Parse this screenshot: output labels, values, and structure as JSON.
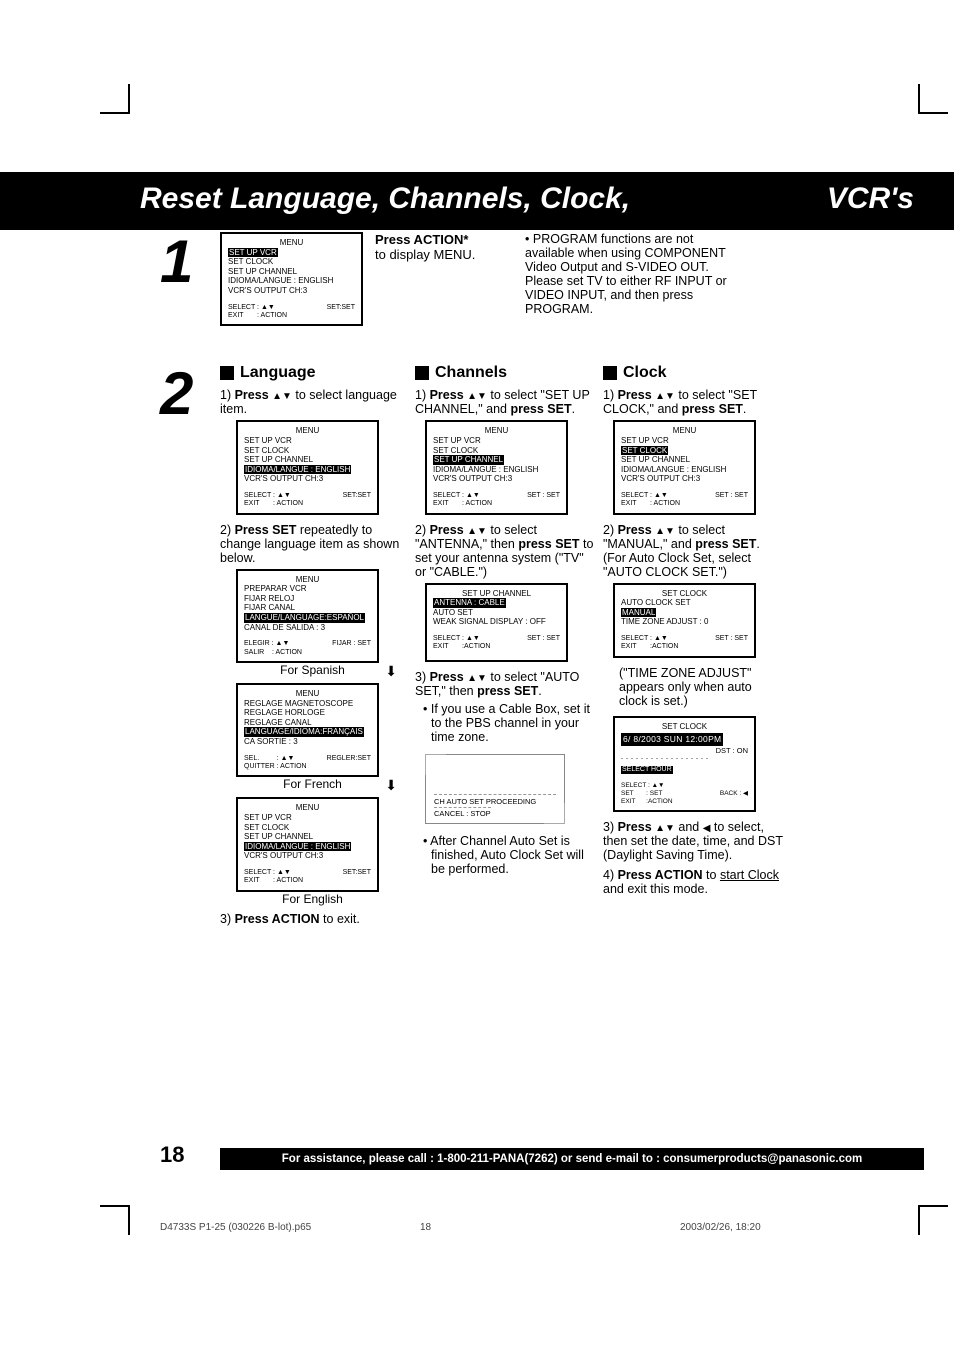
{
  "header": {
    "title_left": "Reset Language, Channels, Clock,",
    "title_right": "VCR's"
  },
  "step1": {
    "num": "1",
    "action_label": "Press ACTION*",
    "action_sub": "to display MENU.",
    "note": "PROGRAM functions are not available when using COMPONENT Video Output and S-VIDEO OUT. Please set TV to either RF INPUT or VIDEO INPUT, and then press PROGRAM.",
    "menu": {
      "title": "MENU",
      "items": [
        "SET UP VCR",
        "SET CLOCK",
        "SET UP CHANNEL",
        "IDIOMA/LANGUE : ENGLISH",
        "VCR'S OUTPUT CH:3"
      ],
      "hl_index": 0,
      "footerL": "SELECT : ▲▼\nEXIT       : ACTION",
      "footerR": "SET:SET"
    }
  },
  "step2": {
    "num": "2",
    "lang": {
      "head": "Language",
      "p1a": "1) ",
      "p1b": "Press ",
      "p1arrows": "▲▼",
      "p1c": " to select language item.",
      "menu1": {
        "title": "MENU",
        "items": [
          "SET UP VCR",
          "SET CLOCK",
          "SET UP CHANNEL",
          "IDIOMA/LANGUE : ENGLISH",
          "VCR'S OUTPUT CH:3"
        ],
        "hl_index": 3,
        "footerL": "SELECT : ▲▼\nEXIT       : ACTION",
        "footerR": "SET:SET"
      },
      "p2a": "2) ",
      "p2b": "Press SET",
      "p2c": " repeatedly to change language item as shown below.",
      "menu_es": {
        "title": "MENU",
        "items": [
          "PREPARAR VCR",
          "FIJAR RELOJ",
          "FIJAR CANAL",
          "LANGUE/LANGUAGE:ESPAÑOL",
          "CANAL DE SALIDA : 3"
        ],
        "hl_index": 3,
        "footerL": "ELEGIR : ▲▼\nSALIR    : ACTION",
        "footerR": "FIJAR : SET"
      },
      "label_es": "For Spanish",
      "menu_fr": {
        "title": "MENU",
        "items": [
          "REGLAGE MAGNETOSCOPE",
          "REGLAGE HORLOGE",
          "REGLAGE CANAL",
          "LANGUAGE/IDIOMA:FRANÇAIS",
          "CA SORTIE : 3"
        ],
        "hl_index": 3,
        "footerL": "SEL.         : ▲▼\nQUITTER : ACTION",
        "footerR": "REGLER:SET"
      },
      "label_fr": "For French",
      "menu_en": {
        "title": "MENU",
        "items": [
          "SET UP VCR",
          "SET CLOCK",
          "SET UP CHANNEL",
          "IDIOMA/LANGUE : ENGLISH",
          "VCR'S OUTPUT CH:3"
        ],
        "hl_index": 3,
        "footerL": "SELECT : ▲▼\nEXIT       : ACTION",
        "footerR": "SET:SET"
      },
      "label_en": "For English",
      "p3a": "3) ",
      "p3b": "Press ACTION",
      "p3c": " to exit."
    },
    "ch": {
      "head": "Channels",
      "p1a": "1) ",
      "p1b": "Press ",
      "p1arrows": "▲▼",
      "p1c": " to select \"SET UP CHANNEL,\" and ",
      "p1d": "press SET",
      "p1e": ".",
      "menu1": {
        "title": "MENU",
        "items": [
          "SET UP VCR",
          "SET CLOCK",
          "SET UP CHANNEL",
          "IDIOMA/LANGUE : ENGLISH",
          "VCR'S OUTPUT CH:3"
        ],
        "hl_index": 2,
        "footerL": "SELECT : ▲▼\nEXIT       : ACTION",
        "footerR": "SET : SET"
      },
      "p2a": "2) ",
      "p2b": "Press ",
      "p2arrows": "▲▼",
      "p2c": " to select \"ANTENNA,\" then ",
      "p2d": "press SET",
      "p2e": " to set your antenna system (\"TV\" or \"CABLE.\")",
      "menu2": {
        "title": "SET UP CHANNEL",
        "items": [
          "ANTENNA : CABLE",
          "AUTO SET",
          "WEAK SIGNAL DISPLAY : OFF"
        ],
        "hl_index": 0,
        "footerL": "SELECT : ▲▼\nEXIT       :ACTION",
        "footerR": "SET : SET"
      },
      "p3a": "3) ",
      "p3b": "Press ",
      "p3arrows": "▲▼",
      "p3c": " to select \"AUTO SET,\" then ",
      "p3d": "press SET",
      "p3e": ".",
      "p3f": "If you use a Cable Box, set it to the PBS channel in your time zone.",
      "tv": {
        "l1": "CH AUTO SET PROCEEDING",
        "l2": "CANCEL : STOP"
      },
      "p4": "After Channel Auto Set is finished, Auto Clock Set will be performed."
    },
    "clk": {
      "head": "Clock",
      "p1a": "1) ",
      "p1b": "Press ",
      "p1arrows": "▲▼",
      "p1c": " to select \"SET CLOCK,\" and ",
      "p1d": "press SET",
      "p1e": ".",
      "menu1": {
        "title": "MENU",
        "items": [
          "SET UP VCR",
          "SET CLOCK",
          "SET UP CHANNEL",
          "IDIOMA/LANGUE : ENGLISH",
          "VCR'S OUTPUT CH:3"
        ],
        "hl_index": 1,
        "footerL": "SELECT : ▲▼\nEXIT       : ACTION",
        "footerR": "SET : SET"
      },
      "p2a": "2) ",
      "p2b": "Press ",
      "p2arrows": "▲▼",
      "p2c": " to select \"MANUAL,\" and ",
      "p2d": "press SET",
      "p2e": ". (For Auto Clock Set, select \"AUTO CLOCK SET.\")",
      "menu2": {
        "title": "SET CLOCK",
        "items": [
          "AUTO CLOCK SET",
          "MANUAL",
          "TIME ZONE ADJUST : 0"
        ],
        "hl_index": 1,
        "footerL": "SELECT : ▲▼\nEXIT       :ACTION",
        "footerR": "SET : SET"
      },
      "note": "(\"TIME ZONE ADJUST\" appears only when auto clock is set.)",
      "menu3": {
        "title": "SET CLOCK",
        "date": "6/ 8/2003 SUN 12:00PM",
        "dst": "DST : ON",
        "sel": "SELECT HOUR",
        "footerL": "SELECT : ▲▼\nSET       : SET\nEXIT      :ACTION",
        "footerR": "BACK : ◀"
      },
      "p3a": "3) ",
      "p3b": "Press ",
      "p3arrows": "▲▼",
      "p3mid": " and ",
      "p3left": "◀",
      "p3c": " to select, then set the date, time, and DST (Daylight Saving Time).",
      "p4a": "4) ",
      "p4b": "Press ACTION",
      "p4c": " to ",
      "p4d": "start Clock",
      "p4e": " and exit this mode."
    }
  },
  "footer": {
    "page": "18",
    "assist": "For assistance, please call : 1-800-211-PANA(7262) or send e-mail to : consumerproducts@panasonic.com",
    "print_file": "D4733S P1-25 (030226 B-lot).p65",
    "print_page": "18",
    "print_date": "2003/02/26, 18:20"
  }
}
